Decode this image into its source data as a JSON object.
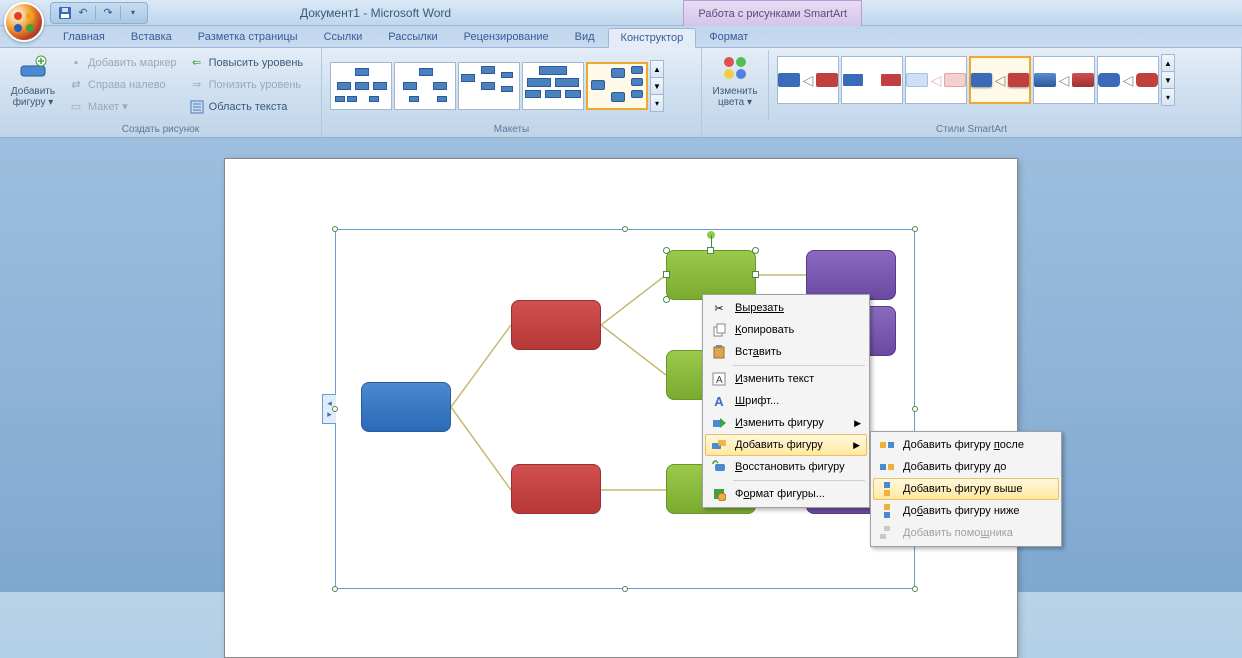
{
  "title": "Документ1 - Microsoft Word",
  "context_title": "Работа с рисунками SmartArt",
  "tabs": {
    "home": "Главная",
    "insert": "Вставка",
    "layout": "Разметка страницы",
    "refs": "Ссылки",
    "mail": "Рассылки",
    "review": "Рецензирование",
    "view": "Вид",
    "design": "Конструктор",
    "format": "Формат"
  },
  "ribbon": {
    "add_shape": {
      "label": "Добавить фигуру",
      "l1": "Добавить",
      "l2": "фигуру"
    },
    "add_bullet": "Добавить маркер",
    "rtl": "Справа налево",
    "layout_btn": "Макет",
    "promote": "Повысить уровень",
    "demote": "Понизить уровень",
    "text_pane": "Область текста",
    "group_create": "Создать рисунок",
    "group_layouts": "Макеты",
    "change_colors": {
      "l1": "Изменить",
      "l2": "цвета"
    },
    "group_styles": "Стили SmartArt"
  },
  "context_menu": {
    "cut": "Вырезать",
    "copy": "Копировать",
    "paste": "Вставить",
    "edit_text": "Изменить текст",
    "font": "Шрифт...",
    "change_shape": "Изменить фигуру",
    "add_shape": "Добавить фигуру",
    "restore_shape": "Восстановить фигуру",
    "format_shape": "Формат фигуры..."
  },
  "submenu": {
    "after": "Добавить фигуру после",
    "before": "Добавить фигуру до",
    "above": "Добавить фигуру выше",
    "below": "Добавить фигуру ниже",
    "assistant": "Добавить помощника"
  }
}
